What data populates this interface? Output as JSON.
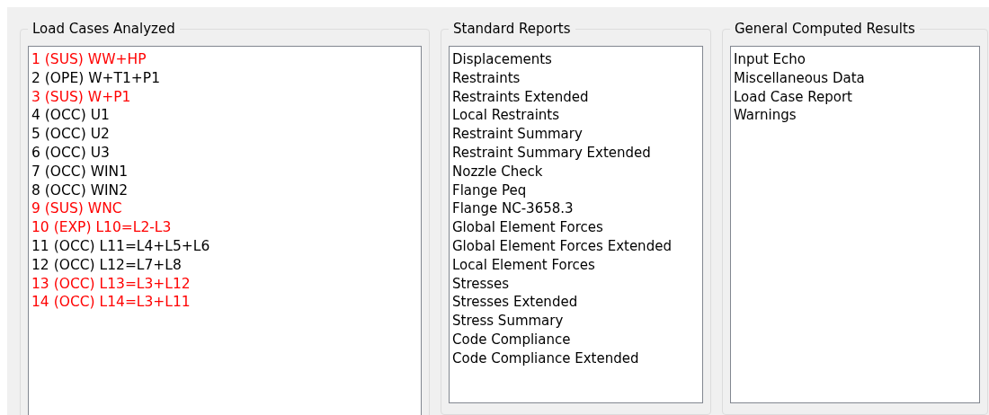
{
  "groups": [
    {
      "title": "Load Cases Analyzed",
      "items": [
        {
          "label": "1 (SUS) WW+HP",
          "color": "#ff0000"
        },
        {
          "label": "2 (OPE) W+T1+P1",
          "color": "#000000"
        },
        {
          "label": "3 (SUS) W+P1",
          "color": "#ff0000"
        },
        {
          "label": "4 (OCC) U1",
          "color": "#000000"
        },
        {
          "label": "5 (OCC) U2",
          "color": "#000000"
        },
        {
          "label": "6 (OCC) U3",
          "color": "#000000"
        },
        {
          "label": "7 (OCC) WIN1",
          "color": "#000000"
        },
        {
          "label": "8 (OCC) WIN2",
          "color": "#000000"
        },
        {
          "label": "9 (SUS) WNC",
          "color": "#ff0000"
        },
        {
          "label": "10 (EXP) L10=L2-L3",
          "color": "#ff0000"
        },
        {
          "label": "11 (OCC) L11=L4+L5+L6",
          "color": "#000000"
        },
        {
          "label": "12 (OCC) L12=L7+L8",
          "color": "#000000"
        },
        {
          "label": "13 (OCC) L13=L3+L12",
          "color": "#ff0000"
        },
        {
          "label": "14 (OCC) L14=L3+L11",
          "color": "#ff0000"
        }
      ]
    },
    {
      "title": "Standard Reports",
      "items": [
        {
          "label": "Displacements"
        },
        {
          "label": "Restraints"
        },
        {
          "label": "Restraints Extended"
        },
        {
          "label": "Local Restraints"
        },
        {
          "label": "Restraint Summary"
        },
        {
          "label": "Restraint Summary Extended"
        },
        {
          "label": "Nozzle Check"
        },
        {
          "label": "Flange Peq"
        },
        {
          "label": "Flange NC-3658.3"
        },
        {
          "label": "Global Element Forces"
        },
        {
          "label": "Global Element Forces Extended"
        },
        {
          "label": "Local Element Forces"
        },
        {
          "label": "Stresses"
        },
        {
          "label": "Stresses Extended"
        },
        {
          "label": "Stress Summary"
        },
        {
          "label": "Code Compliance"
        },
        {
          "label": "Code Compliance Extended"
        }
      ]
    },
    {
      "title": "General Computed Results",
      "items": [
        {
          "label": "Input Echo"
        },
        {
          "label": "Miscellaneous Data"
        },
        {
          "label": "Load Case Report"
        },
        {
          "label": "Warnings"
        }
      ]
    }
  ]
}
